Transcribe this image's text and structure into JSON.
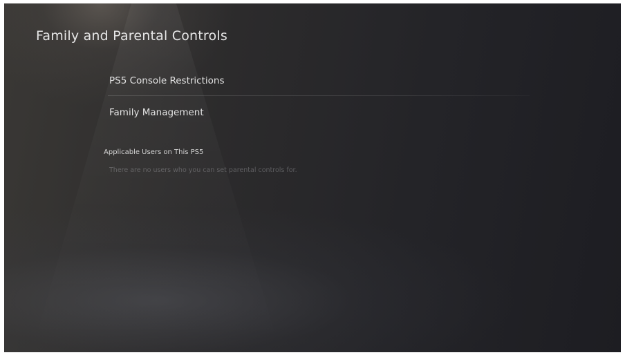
{
  "page": {
    "title": "Family and Parental Controls"
  },
  "menu": {
    "items": [
      {
        "label": "PS5 Console Restrictions"
      },
      {
        "label": "Family Management"
      }
    ]
  },
  "applicable_users": {
    "heading": "Applicable Users on This PS5",
    "empty_message": "There are no users who you can set parental controls for."
  }
}
